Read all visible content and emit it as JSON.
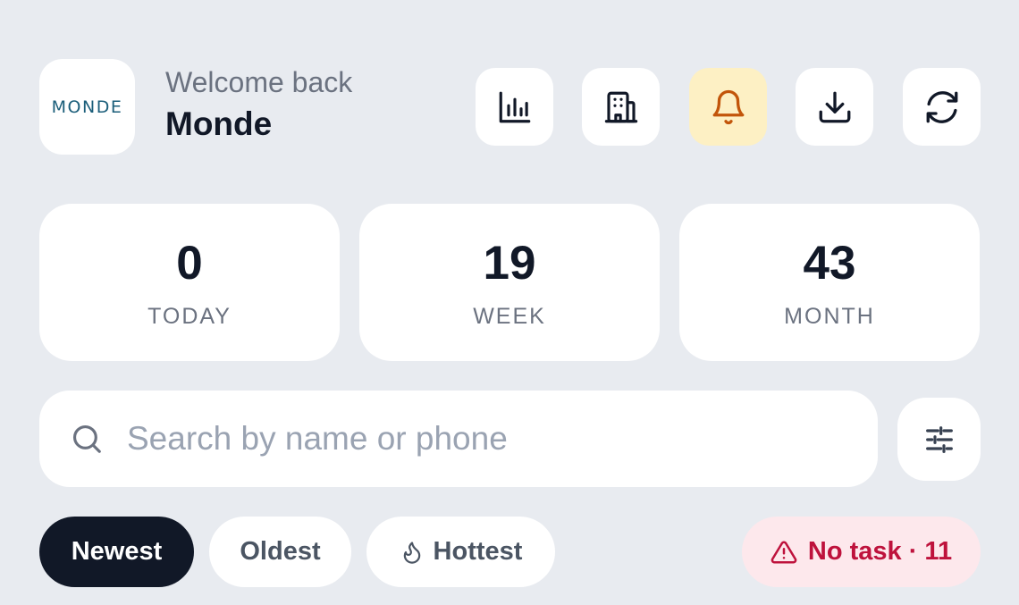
{
  "header": {
    "logo_text": "MONDE",
    "welcome": "Welcome back",
    "name": "Monde",
    "actions": [
      {
        "icon": "bar-chart-icon"
      },
      {
        "icon": "building-icon"
      },
      {
        "icon": "bell-icon",
        "active": true
      },
      {
        "icon": "download-icon"
      },
      {
        "icon": "refresh-icon"
      }
    ]
  },
  "stats": [
    {
      "value": "0",
      "label": "TODAY"
    },
    {
      "value": "19",
      "label": "WEEK"
    },
    {
      "value": "43",
      "label": "MONTH"
    }
  ],
  "search": {
    "placeholder": "Search by name or phone",
    "value": ""
  },
  "filters": {
    "sort_options": [
      {
        "label": "Newest",
        "selected": true
      },
      {
        "label": "Oldest",
        "selected": false
      },
      {
        "label": "Hottest",
        "selected": false,
        "icon": "flame-icon"
      }
    ],
    "alert": {
      "label": "No task · 11",
      "icon": "warning-icon"
    }
  },
  "colors": {
    "background": "#e8ebf0",
    "selected_chip": "#111827",
    "bell_active_bg": "#fdf0c4",
    "bell_active_fg": "#c2550a",
    "alert_bg": "#fde8ec",
    "alert_fg": "#be123c"
  }
}
